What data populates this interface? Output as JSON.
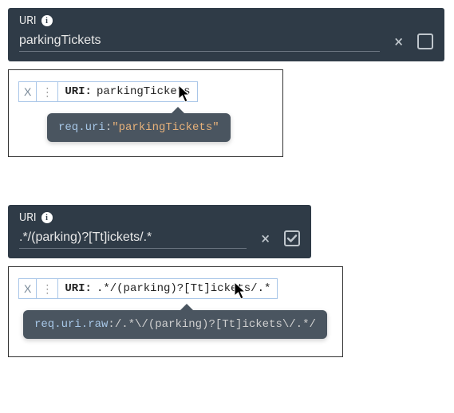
{
  "example1": {
    "panel": {
      "title": "URI",
      "value": "parkingTickets",
      "regexChecked": false
    },
    "chip": {
      "key": "URI:",
      "value": "parkingTickets"
    },
    "tooltip": {
      "key": "req.uri",
      "op": ":",
      "literal": "\"parkingTickets\""
    }
  },
  "example2": {
    "panel": {
      "title": "URI",
      "value": ".*/(parking)?[Tt]ickets/.*",
      "regexChecked": true
    },
    "chip": {
      "key": "URI:",
      "value": ".*/(parking)?[Tt]ickets/.*"
    },
    "tooltip": {
      "key": "req.uri.raw",
      "op": ":",
      "regex": "/.*\\/(parking)?[Tt]ickets\\/.*/"
    }
  }
}
